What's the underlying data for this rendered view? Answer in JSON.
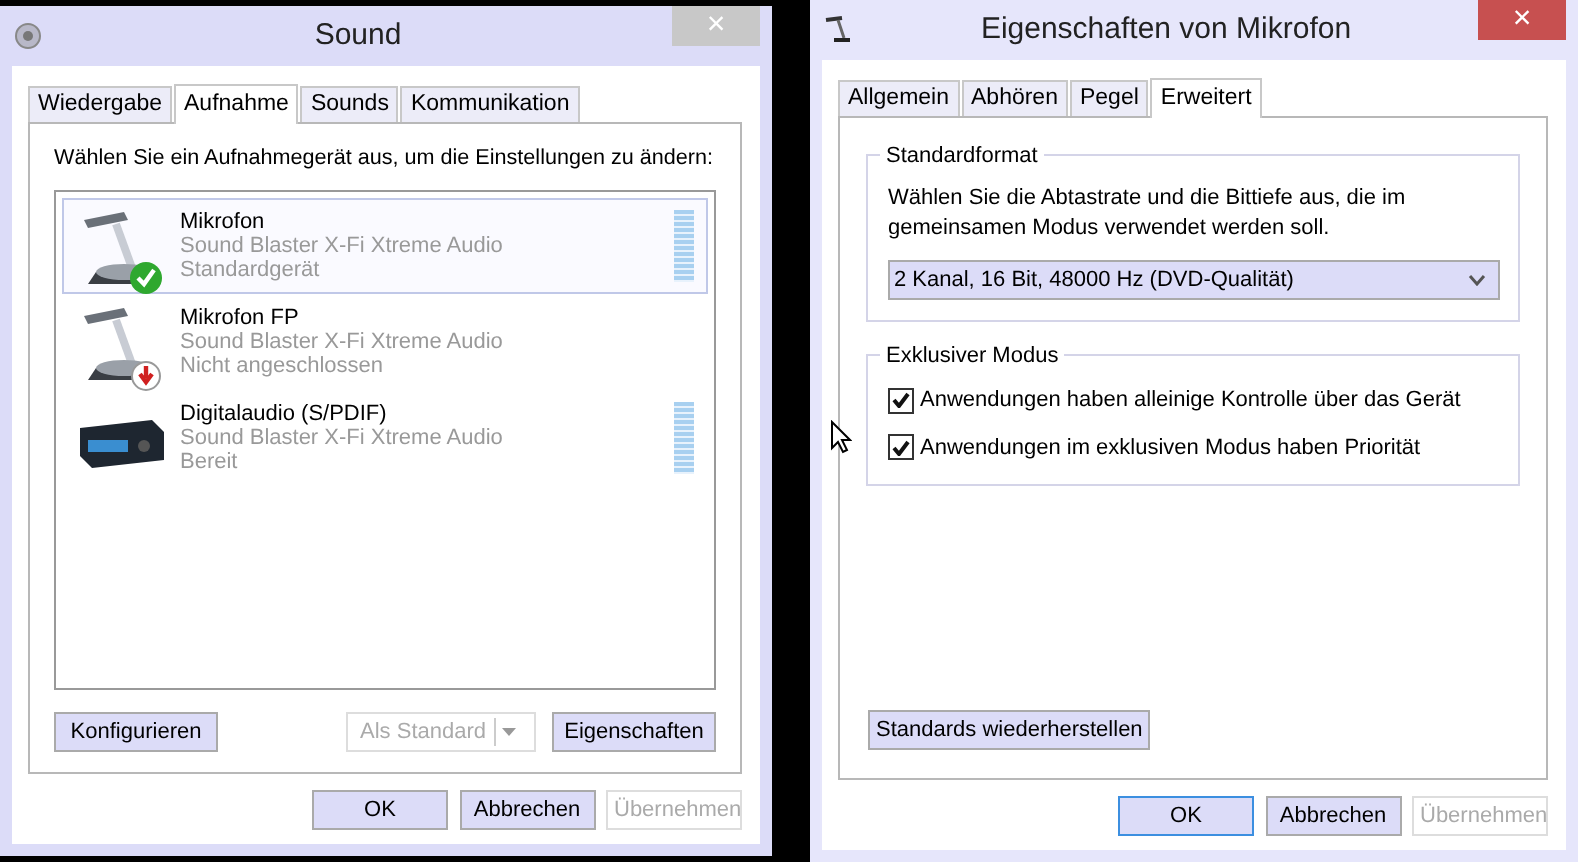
{
  "sound_window": {
    "title": "Sound",
    "active": false,
    "close": "×",
    "tabs": [
      {
        "label": "Wiedergabe",
        "selected": false
      },
      {
        "label": "Aufnahme",
        "selected": true
      },
      {
        "label": "Sounds",
        "selected": false
      },
      {
        "label": "Kommunikation",
        "selected": false
      }
    ],
    "instruction": "Wählen Sie ein Aufnahmegerät aus, um die Einstellungen zu ändern:",
    "devices": [
      {
        "kind": "microphone",
        "name": "Mikrofon",
        "driver": "Sound Blaster X-Fi Xtreme Audio",
        "status": "Standardgerät",
        "default": true,
        "unplugged": false,
        "meter": true,
        "selected": true
      },
      {
        "kind": "microphone",
        "name": "Mikrofon FP",
        "driver": "Sound Blaster X-Fi Xtreme Audio",
        "status": "Nicht angeschlossen",
        "default": false,
        "unplugged": true,
        "meter": false,
        "selected": false
      },
      {
        "kind": "digital",
        "name": "Digitalaudio (S/PDIF)",
        "driver": "Sound Blaster X-Fi Xtreme Audio",
        "status": "Bereit",
        "default": false,
        "unplugged": false,
        "meter": true,
        "selected": false
      }
    ],
    "configure_button": {
      "label": "Konfigurieren",
      "disabled": false
    },
    "set_default_button": {
      "label": "Als Standard",
      "disabled": true
    },
    "properties_button": {
      "label": "Eigenschaften",
      "disabled": false
    },
    "buttons": [
      {
        "label": "OK",
        "disabled": false,
        "focused": false
      },
      {
        "label": "Abbrechen",
        "disabled": false,
        "focused": false
      },
      {
        "label": "Übernehmen",
        "disabled": true,
        "focused": false
      }
    ]
  },
  "properties_window": {
    "title": "Eigenschaften von Mikrofon",
    "active": true,
    "close": "×",
    "tabs": [
      {
        "label": "Allgemein",
        "selected": false
      },
      {
        "label": "Abhören",
        "selected": false
      },
      {
        "label": "Pegel",
        "selected": false
      },
      {
        "label": "Erweitert",
        "selected": true
      }
    ],
    "default_format": {
      "legend": "Standardformat",
      "description": "Wählen Sie die Abtastrate und die Bittiefe aus, die im gemeinsamen Modus verwendet werden soll.",
      "value": "2 Kanal, 16 Bit, 48000 Hz (DVD-Qualität)"
    },
    "exclusive_mode": {
      "legend": "Exklusiver Modus",
      "options": [
        {
          "label": "Anwendungen haben alleinige Kontrolle über das Gerät",
          "checked": true
        },
        {
          "label": "Anwendungen im exklusiven Modus haben Priorität",
          "checked": true
        }
      ]
    },
    "restore_button": {
      "label": "Standards wiederherstellen",
      "disabled": false
    },
    "buttons": [
      {
        "label": "OK",
        "disabled": false,
        "focused": true
      },
      {
        "label": "Abbrechen",
        "disabled": false,
        "focused": false
      },
      {
        "label": "Übernehmen",
        "disabled": true,
        "focused": false
      }
    ]
  }
}
